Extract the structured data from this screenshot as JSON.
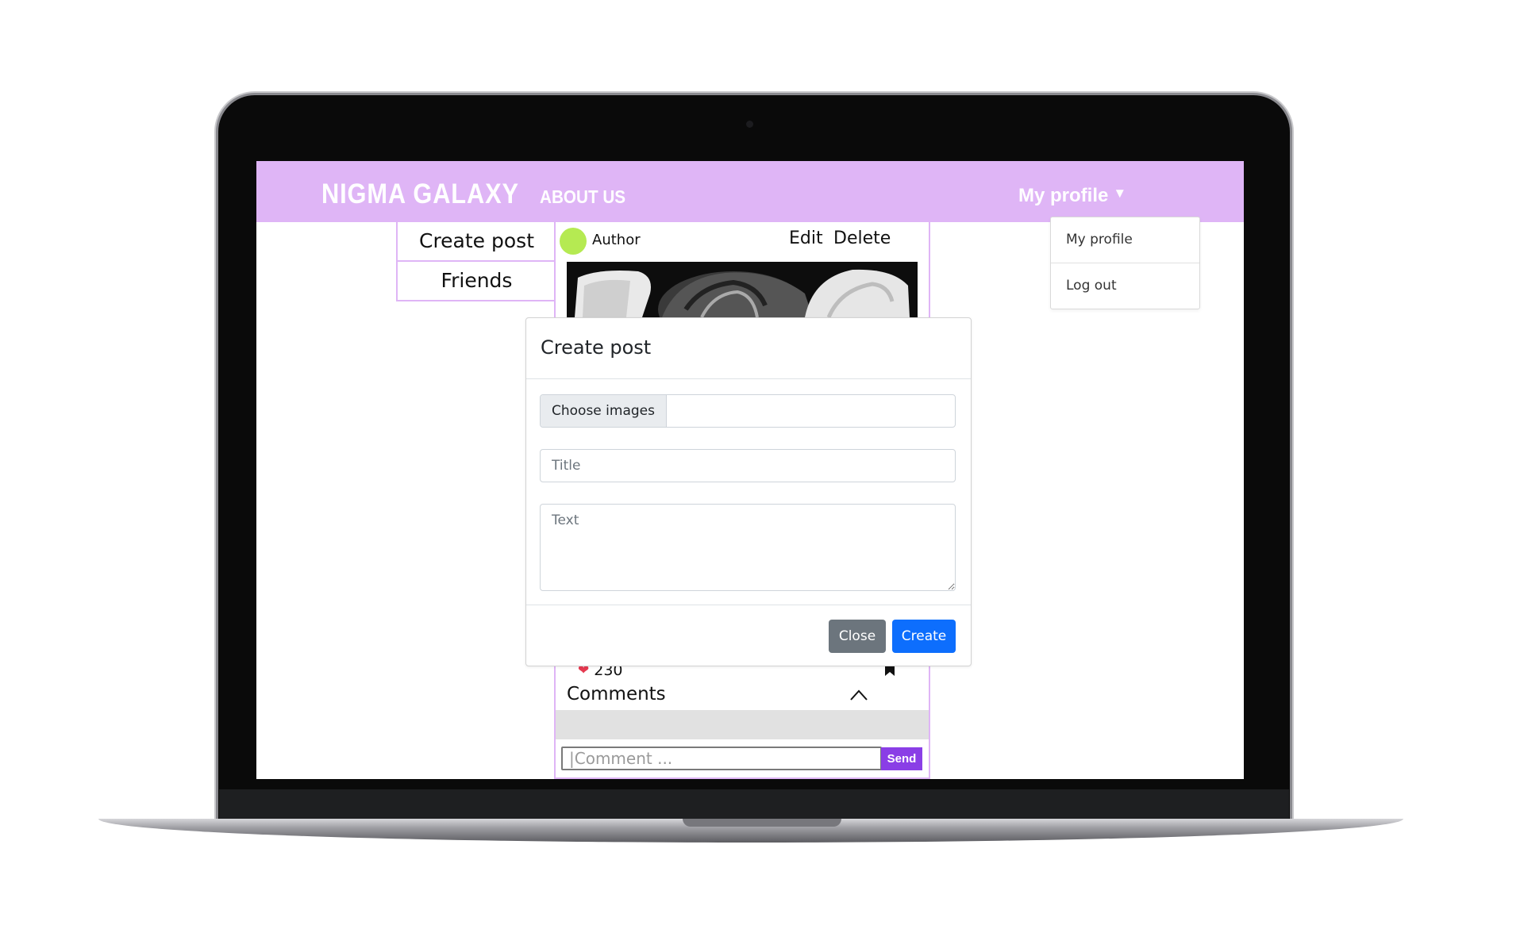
{
  "navbar": {
    "brand": "NIGMA GALAXY",
    "about_link": "ABOUT US",
    "profile_menu_label": "My profile",
    "profile_caret": "▼",
    "accent_color": "#dfb5f6"
  },
  "profile_dropdown": {
    "items": [
      {
        "label": "My profile"
      },
      {
        "label": "Log out"
      }
    ]
  },
  "side_menu": {
    "items": [
      {
        "label": "Create post"
      },
      {
        "label": "Friends"
      }
    ]
  },
  "post": {
    "author": "Author",
    "avatar_color": "#b5ea52",
    "edit_label": "Edit",
    "delete_label": "Delete",
    "likes": "230",
    "comments_title": "Comments",
    "comment_placeholder": "|Comment ...",
    "send_label": "Send",
    "icons": [
      "heart-icon",
      "bookmark-icon",
      "chevron-up-icon"
    ]
  },
  "modal": {
    "title": "Create post",
    "file_button_label": "Choose images",
    "title_placeholder": "Title",
    "text_placeholder": "Text",
    "close_label": "Close",
    "create_label": "Create",
    "primary_color": "#0d6efd",
    "secondary_color": "#6c757d"
  }
}
